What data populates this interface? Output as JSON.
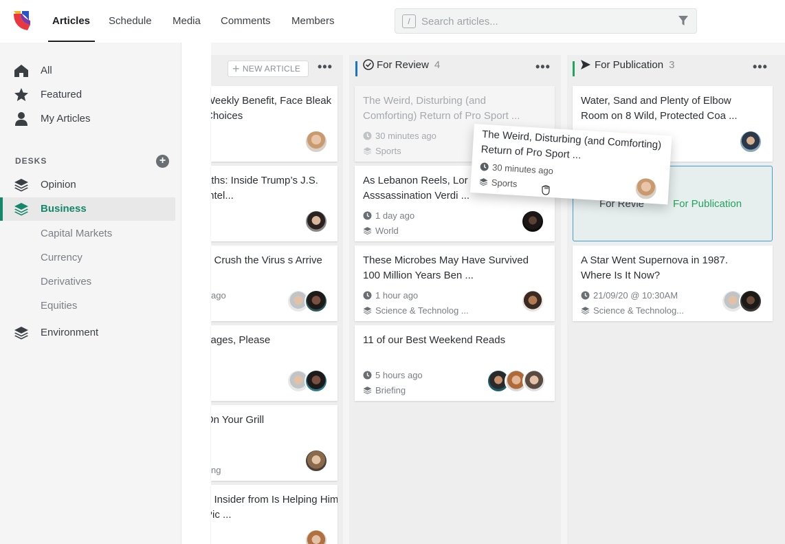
{
  "nav": {
    "tabs": [
      {
        "label": "Articles",
        "active": true
      },
      {
        "label": "Schedule"
      },
      {
        "label": "Media"
      },
      {
        "label": "Comments"
      },
      {
        "label": "Members"
      }
    ]
  },
  "search": {
    "placeholder": "Search articles...",
    "shortcut": "/",
    "icon": "filter-icon"
  },
  "sidebar": {
    "items": [
      {
        "label": "All",
        "icon": "home-icon"
      },
      {
        "label": "Featured",
        "icon": "star-icon"
      },
      {
        "label": "My Articles",
        "icon": "user-icon"
      }
    ],
    "desks_heading": "DESKS",
    "desks": [
      {
        "label": "Opinion",
        "icon": "layers-icon"
      },
      {
        "label": "Business",
        "icon": "layers-icon",
        "active": true,
        "children": [
          "Capital Markets",
          "Currency",
          "Derivatives",
          "Equities"
        ]
      },
      {
        "label": "Environment",
        "icon": "layers-icon"
      }
    ]
  },
  "colors": {
    "accent": "#16866a",
    "review": "#1a73c7",
    "publication": "#22a35a",
    "drop_border": "#3d9fd6"
  },
  "columns": {
    "left": {
      "new_article": "NEW ARTICLE",
      "cards": [
        {
          "title": "Weekly Benefit, Face Bleak Choices"
        },
        {
          "title": "aths: Inside Trump’s J.S. Intel..."
        },
        {
          "title": "o Crush the Virus s Arrive",
          "meta": "ago"
        },
        {
          "title": "sages, Please"
        },
        {
          "title": "On Your Grill",
          "meta": "ng"
        },
        {
          "title": "n Insider from Is Helping Him Pic ..."
        }
      ]
    },
    "review": {
      "title": "For Review",
      "count": "4",
      "cards": [
        {
          "title": "The Weird, Disturbing (and Comforting) Return of Pro Sport ...",
          "time": "30 minutes ago",
          "desk": "Sports"
        },
        {
          "title": "As Lebanon Reels, Lor Asssassination Verdi ...",
          "time": "1 day ago",
          "desk": "World"
        },
        {
          "title": "These Microbes May Have Survived 100 Million Years Ben ...",
          "time": "1 hour ago",
          "desk": "Science & Technolog ..."
        },
        {
          "title": "11 of our Best Weekend Reads",
          "time": "5 hours ago",
          "desk": "Briefing"
        }
      ]
    },
    "publication": {
      "title": "For Publication",
      "count": "3",
      "cards": [
        {
          "title": "Water, Sand and Plenty of Elbow Room on 8 Wild, Protected Coa ..."
        },
        {
          "title": "A Star Went Supernova in 1987. Where Is It Now?",
          "time": "21/09/20 @ 10:30AM",
          "desk": "Science & Technolog..."
        }
      ],
      "drop_label": "For Publication",
      "drop_under": "For Revie"
    }
  },
  "drag": {
    "title": "The Weird, Disturbing (and Comforting) Return of Pro Sport ...",
    "time": "30 minutes ago",
    "desk": "Sports"
  }
}
